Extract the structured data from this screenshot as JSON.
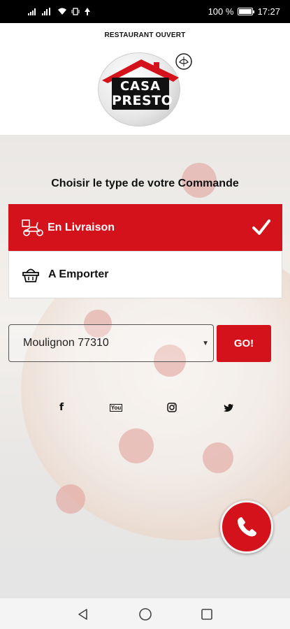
{
  "status_bar": {
    "battery": "100 %",
    "time": "17:27",
    "battery_level": 1.0
  },
  "header": {
    "restaurant_status": "RESTAURANT OUVERT",
    "logo": {
      "line1": "CASA",
      "line2": "PRESTO"
    }
  },
  "order": {
    "title": "Choisir le type de votre Commande",
    "options": [
      {
        "label": "En Livraison",
        "icon": "delivery-scooter-icon",
        "selected": true
      },
      {
        "label": "A Emporter",
        "icon": "basket-icon",
        "selected": false
      }
    ],
    "city_value": "Moulignon 77310",
    "go_label": "GO!"
  },
  "social": {
    "facebook": "f",
    "youtube": "You",
    "instagram": "instagram-icon",
    "twitter": "twitter-icon"
  },
  "colors": {
    "accent": "#d3121b",
    "text": "#111111"
  },
  "nav": {
    "back": "back-icon",
    "home": "home-icon",
    "recents": "recents-icon"
  }
}
